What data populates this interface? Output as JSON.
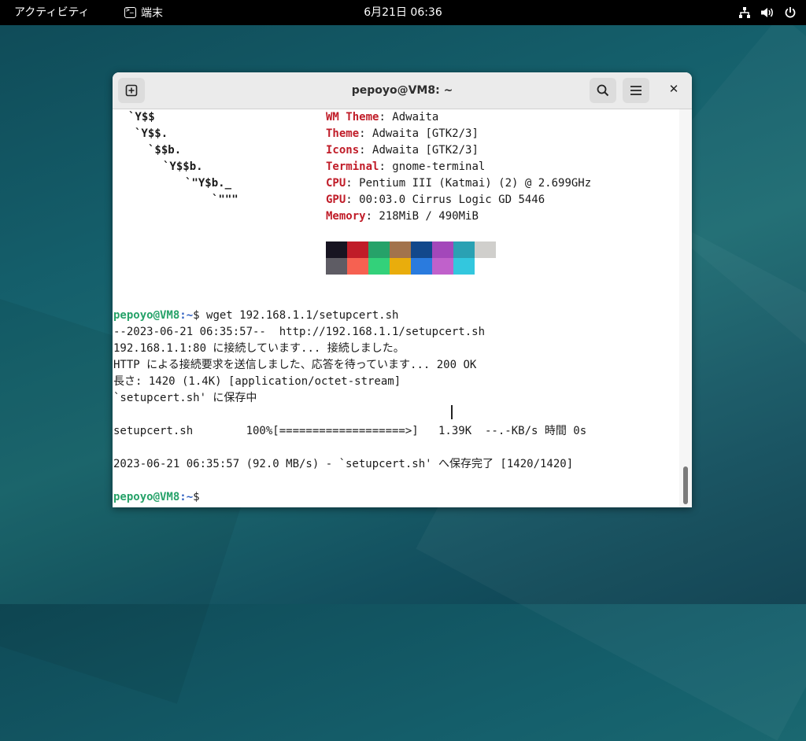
{
  "topbar": {
    "activities": "アクティビティ",
    "app_name": "端末",
    "clock": "6月21日 06:36"
  },
  "window": {
    "title": "pepoyo@VM8: ~",
    "close_glyph": "✕"
  },
  "ascii_art": [
    "`Y$$",
    "`Y$$.",
    "`$$b.",
    "`Y$$b.",
    "`\"Y$b._",
    "`\"\"\""
  ],
  "sysinfo": [
    {
      "label": "WM Theme",
      "value": ": Adwaita"
    },
    {
      "label": "Theme",
      "value": ": Adwaita [GTK2/3]"
    },
    {
      "label": "Icons",
      "value": ": Adwaita [GTK2/3]"
    },
    {
      "label": "Terminal",
      "value": ": gnome-terminal"
    },
    {
      "label": "CPU",
      "value": ": Pentium III (Katmai) (2) @ 2.699GHz"
    },
    {
      "label": "GPU",
      "value": ": 00:03.0 Cirrus Logic GD 5446"
    },
    {
      "label": "Memory",
      "value": ": 218MiB / 490MiB"
    }
  ],
  "palette": {
    "row1": [
      "#171421",
      "#c01c28",
      "#26a269",
      "#a2734c",
      "#12488b",
      "#a347ba",
      "#2aa1b3",
      "#d0cfcc"
    ],
    "row2": [
      "#5e5c64",
      "#f66151",
      "#33d17a",
      "#e9ad0c",
      "#2a7bde",
      "#c061cb",
      "#33c7de"
    ]
  },
  "prompt": {
    "user": "pepoyo@VM8",
    "path": ":~",
    "symbol": "$"
  },
  "commands": {
    "first": " wget 192.168.1.1/setupcert.sh",
    "last": ""
  },
  "output": [
    "--2023-06-21 06:35:57--  http://192.168.1.1/setupcert.sh",
    "192.168.1.1:80 に接続しています... 接続しました。",
    "HTTP による接続要求を送信しました、応答を待っています... 200 OK",
    "長さ: 1420 (1.4K) [application/octet-stream]",
    "`setupcert.sh' に保存中",
    "",
    "setupcert.sh        100%[===================>]   1.39K  --.-KB/s 時間 0s",
    "",
    "2023-06-21 06:35:57 (92.0 MB/s) - `setupcert.sh' へ保存完了 [1420/1420]"
  ],
  "colors": {
    "label_red": "#c01c28",
    "prompt_green": "#26a269",
    "prompt_blue": "#3060c0",
    "topbar": "#000000"
  },
  "icons": [
    "terminal-icon",
    "network-icon",
    "volume-icon",
    "power-icon",
    "new-tab-icon",
    "search-icon",
    "hamburger-menu-icon",
    "close-icon"
  ]
}
